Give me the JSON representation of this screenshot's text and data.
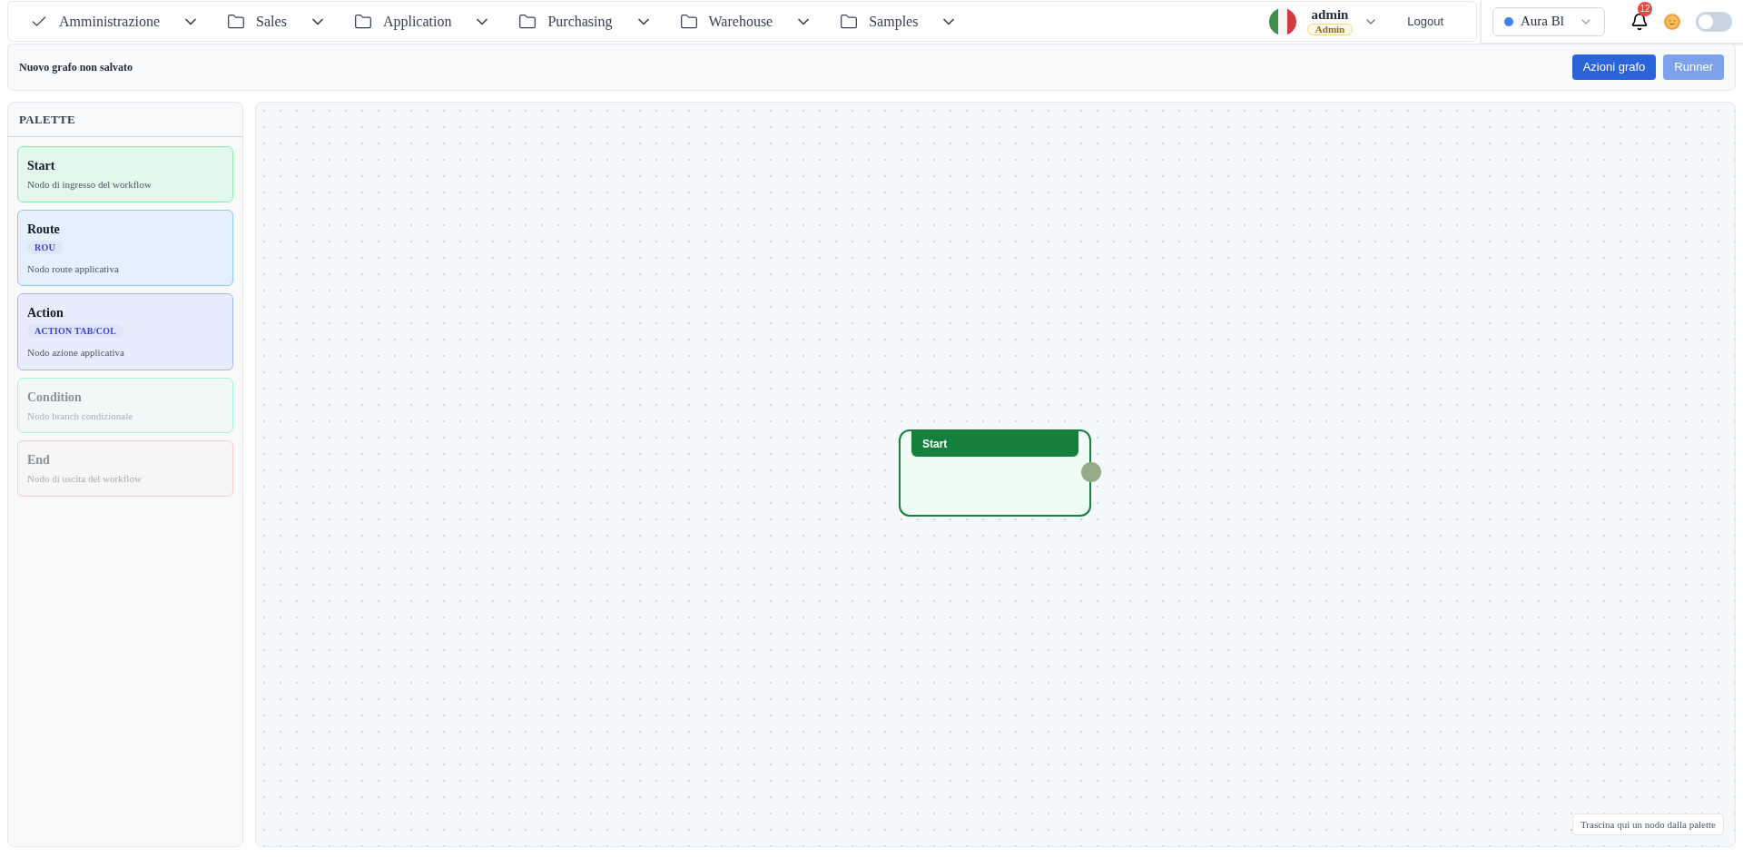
{
  "menu": [
    {
      "label": "Amministrazione",
      "kind": "check"
    },
    {
      "label": "Sales",
      "kind": "folder"
    },
    {
      "label": "Application",
      "kind": "folder"
    },
    {
      "label": "Purchasing",
      "kind": "folder"
    },
    {
      "label": "Warehouse",
      "kind": "folder"
    },
    {
      "label": "Samples",
      "kind": "folder"
    }
  ],
  "user": {
    "name": "admin",
    "role": "Admin",
    "logout": "Logout"
  },
  "theme_select": {
    "value": "Aura Bl",
    "color": "#3b82f6"
  },
  "notifications": {
    "count": "12"
  },
  "dark_mode": {
    "on": false
  },
  "toolbar": {
    "title": "Nuovo grafo non salvato",
    "buttons": [
      {
        "label": "Azioni grafo",
        "disabled": false
      },
      {
        "label": "Runner",
        "disabled": true
      }
    ]
  },
  "palette": {
    "title": "PALETTE",
    "items": [
      {
        "title": "Start",
        "description": "Nodo di ingresso del workflow",
        "color": "#86efac",
        "disabled": false
      },
      {
        "title": "Route",
        "tag": "ROU",
        "description": "Nodo route applicativa",
        "color": "#93c5fd",
        "disabled": false
      },
      {
        "title": "Action",
        "tag": "ACTION TAB/COL",
        "description": "Nodo azione applicativa",
        "color": "#a5b4fc",
        "disabled": false
      },
      {
        "title": "Condition",
        "description": "Nodo branch condizionale",
        "color": "#a7f3d0",
        "disabled": true
      },
      {
        "title": "End",
        "description": "Nodo di uscita del workflow",
        "color": "#fecaca",
        "disabled": true
      }
    ]
  },
  "canvas": {
    "nodes": [
      {
        "title": "Start"
      }
    ],
    "hint": "Trascina qui un nodo dalla palette"
  }
}
